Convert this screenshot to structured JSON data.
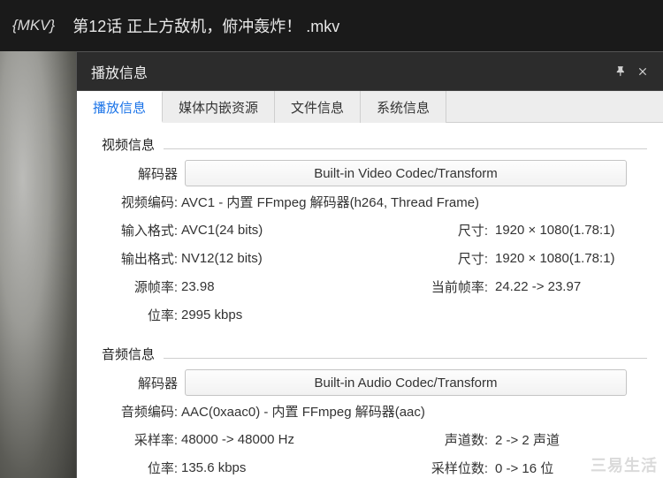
{
  "title": {
    "ext_tag": "{MKV}",
    "filename": "第12话 正上方敌机，俯冲轰炸！ .mkv"
  },
  "panel": {
    "title": "播放信息",
    "tabs": [
      {
        "label": "播放信息",
        "active": true
      },
      {
        "label": "媒体内嵌资源",
        "active": false
      },
      {
        "label": "文件信息",
        "active": false
      },
      {
        "label": "系统信息",
        "active": false
      }
    ]
  },
  "video": {
    "group_title": "视频信息",
    "decoder_label": "解码器",
    "decoder_btn": "Built-in Video Codec/Transform",
    "rows": [
      {
        "label": "视频编码:",
        "value": "AVC1 - 内置 FFmpeg 解码器(h264, Thread Frame)"
      },
      {
        "label": "输入格式:",
        "value": "AVC1(24 bits)",
        "sublabel": "尺寸:",
        "subvalue": "1920 × 1080(1.78:1)"
      },
      {
        "label": "输出格式:",
        "value": "NV12(12 bits)",
        "sublabel": "尺寸:",
        "subvalue": "1920 × 1080(1.78:1)"
      },
      {
        "label": "源帧率:",
        "value": "23.98",
        "sublabel": "当前帧率:",
        "subvalue": "24.22 -> 23.97"
      },
      {
        "label": "位率:",
        "value": "2995 kbps"
      }
    ]
  },
  "audio": {
    "group_title": "音频信息",
    "decoder_label": "解码器",
    "decoder_btn": "Built-in Audio Codec/Transform",
    "rows": [
      {
        "label": "音频编码:",
        "value": "AAC(0xaac0) - 内置 FFmpeg 解码器(aac)"
      },
      {
        "label": "采样率:",
        "value": "48000 -> 48000 Hz",
        "sublabel": "声道数:",
        "subvalue": "2 -> 2 声道"
      },
      {
        "label": "位率:",
        "value": "135.6 kbps",
        "sublabel": "采样位数:",
        "subvalue": "0 -> 16 位"
      }
    ]
  },
  "watermark": "三易生活"
}
